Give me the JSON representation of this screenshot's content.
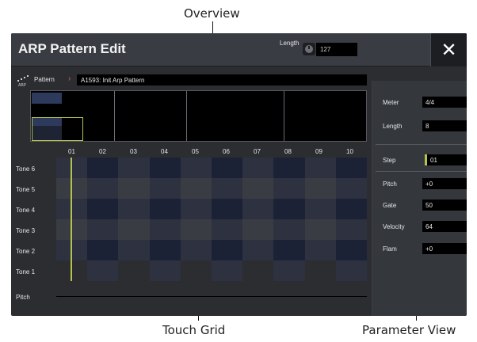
{
  "callouts": {
    "overview": "Overview",
    "touch_grid": "Touch Grid",
    "parameter_view": "Parameter View"
  },
  "window": {
    "title": "ARP Pattern Edit",
    "length_label": "Length",
    "length_value": "127",
    "close_label": "✕"
  },
  "pattern": {
    "label": "Pattern",
    "chevron": "›",
    "value": "A1593: Init Arp Pattern"
  },
  "params": {
    "meter": {
      "label": "Meter",
      "value": "4/4"
    },
    "length": {
      "label": "Length",
      "value": "8"
    },
    "step": {
      "label": "Step",
      "value": "01"
    },
    "pitch": {
      "label": "Pitch",
      "value": "+0"
    },
    "gate": {
      "label": "Gate",
      "value": "50"
    },
    "velocity": {
      "label": "Velocity",
      "value": "64"
    },
    "flam": {
      "label": "Flam",
      "value": "+0"
    }
  },
  "grid": {
    "columns": [
      "01",
      "02",
      "03",
      "04",
      "05",
      "06",
      "07",
      "08",
      "09",
      "10"
    ],
    "tones": [
      "Tone 6",
      "Tone 5",
      "Tone 4",
      "Tone 3",
      "Tone 2",
      "Tone 1"
    ],
    "pitch_label": "Pitch"
  },
  "colors": {
    "accent": "#b8c24b",
    "chevron": "#e0527a",
    "cell_dark": "#1c2236",
    "cell_mid": "#2e3140",
    "cell_light": "#3a3c44",
    "screen_bg": "#2b2d31"
  },
  "icons": {
    "arp": "arp-icon",
    "knob": "knob-icon",
    "close": "close-icon"
  }
}
